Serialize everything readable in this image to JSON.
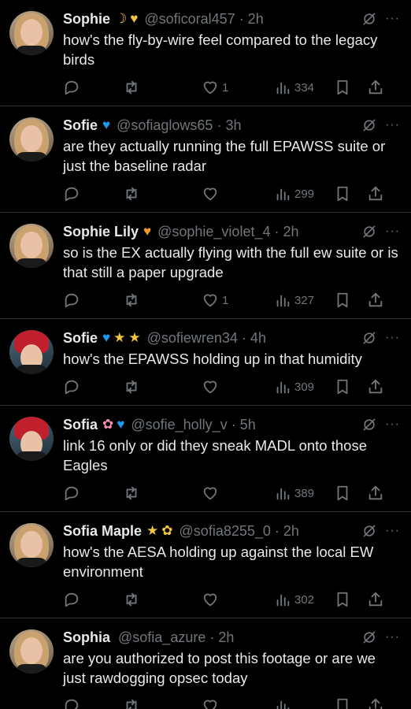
{
  "tweets": [
    {
      "avatar": "blonde",
      "name": "Sophie",
      "badges": [
        {
          "glyph": "☽",
          "cls": "moon"
        },
        {
          "glyph": "♥",
          "cls": "heart-yellow"
        }
      ],
      "handle": "@soficoral457",
      "time": "2h",
      "text": "how's the fly-by-wire feel compared to the legacy birds",
      "likes": "1",
      "views": "334"
    },
    {
      "avatar": "blonde",
      "name": "Sofie",
      "badges": [
        {
          "glyph": "♥",
          "cls": "heart-blue"
        }
      ],
      "handle": "@sofiaglows65",
      "time": "3h",
      "text": "are they actually running the full EPAWSS suite or just the baseline radar",
      "likes": "",
      "views": "299"
    },
    {
      "avatar": "blonde",
      "name": "Sophie Lily",
      "badges": [
        {
          "glyph": "♥",
          "cls": "heart-orange"
        }
      ],
      "handle": "@sophie_violet_4",
      "time": "2h",
      "text": "so is the EX actually flying with the full ew suite or is that still a paper upgrade",
      "likes": "1",
      "views": "327"
    },
    {
      "avatar": "red",
      "name": "Sofie",
      "badges": [
        {
          "glyph": "♥",
          "cls": "heart-blue"
        },
        {
          "glyph": "★",
          "cls": "star"
        },
        {
          "glyph": "★",
          "cls": "star"
        }
      ],
      "handle": "@sofiewren34",
      "time": "4h",
      "text": "how's the EPAWSS holding up in that humidity",
      "likes": "",
      "views": "309"
    },
    {
      "avatar": "red",
      "name": "Sofia",
      "badges": [
        {
          "glyph": "✿",
          "cls": "flower-pink"
        },
        {
          "glyph": "♥",
          "cls": "heart-blue"
        }
      ],
      "handle": "@sofie_holly_v",
      "time": "5h",
      "text": "link 16 only or did they sneak MADL onto those Eagles",
      "likes": "",
      "views": "389"
    },
    {
      "avatar": "blonde",
      "name": "Sofia Maple",
      "badges": [
        {
          "glyph": "★",
          "cls": "star"
        },
        {
          "glyph": "✿",
          "cls": "flower-yellow"
        }
      ],
      "handle": "@sofia8255_0",
      "time": "2h",
      "text": "how's the AESA holding up against the local EW environment",
      "likes": "",
      "views": "302"
    },
    {
      "avatar": "blonde",
      "name": "Sophia",
      "badges": [],
      "handle": "@sofia_azure",
      "time": "2h",
      "text": "are you authorized to post this footage or are we just rawdogging opsec today",
      "likes": "",
      "views": ""
    }
  ],
  "icons": {
    "reply": "reply-icon",
    "retweet": "retweet-icon",
    "like": "heart-icon",
    "views": "views-icon",
    "bookmark": "bookmark-icon",
    "share": "share-icon",
    "grok": "grok-icon",
    "more": "more-icon"
  },
  "more_glyph": "···",
  "time_sep": "·"
}
